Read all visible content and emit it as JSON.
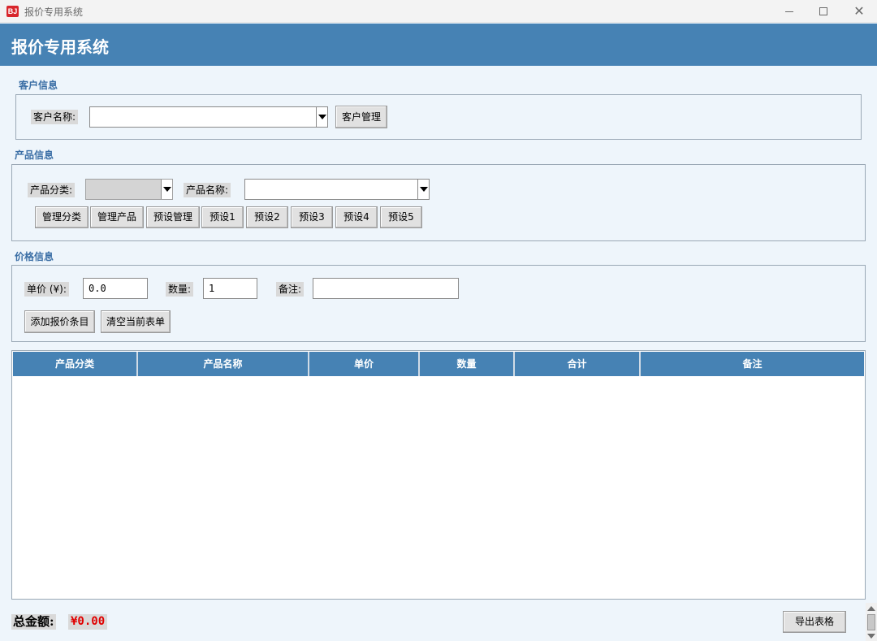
{
  "window": {
    "icon_text": "BJ",
    "title": "报价专用系统",
    "controls": {
      "minimize": "minimize-icon",
      "maximize": "maximize-icon",
      "close": "close-icon",
      "close_glyph": "✕"
    }
  },
  "header": {
    "title": "报价专用系统"
  },
  "customer": {
    "section_label": "客户信息",
    "name_label": "客户名称:",
    "name_value": "",
    "manage_button": "客户管理"
  },
  "product": {
    "section_label": "产品信息",
    "category_label": "产品分类:",
    "category_value": "",
    "name_label": "产品名称:",
    "name_value": "",
    "buttons": [
      "管理分类",
      "管理产品",
      "预设管理",
      "预设1",
      "预设2",
      "预设3",
      "预设4",
      "预设5"
    ]
  },
  "price": {
    "section_label": "价格信息",
    "unit_price_label": "单价 (¥):",
    "unit_price_value": "0.0",
    "quantity_label": "数量:",
    "quantity_value": "1",
    "note_label": "备注:",
    "note_value": "",
    "add_button": "添加报价条目",
    "clear_button": "清空当前表单"
  },
  "table": {
    "columns": [
      "产品分类",
      "产品名称",
      "单价",
      "数量",
      "合计",
      "备注"
    ],
    "rows": []
  },
  "footer": {
    "total_label": "总金额:",
    "total_value": "¥0.00",
    "export_button": "导出表格"
  },
  "colors": {
    "header_bg": "#4682b4",
    "section_label": "#3a6ea5",
    "total_value": "#e00000",
    "page_bg": "#eef5fb"
  }
}
